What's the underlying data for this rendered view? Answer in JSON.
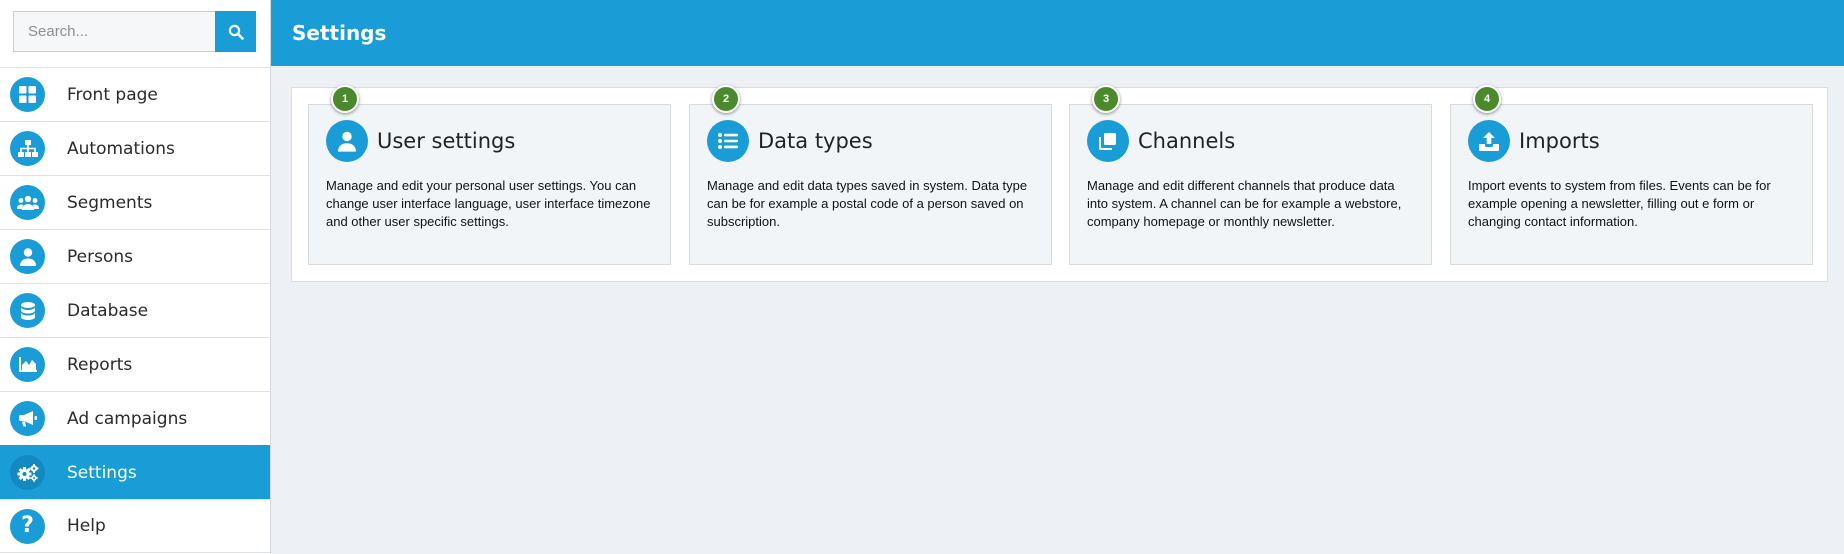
{
  "search": {
    "placeholder": "Search..."
  },
  "header": {
    "title": "Settings"
  },
  "sidebar": {
    "items": [
      {
        "label": "Front page",
        "icon": "grid-icon",
        "active": false
      },
      {
        "label": "Automations",
        "icon": "sitemap-icon",
        "active": false
      },
      {
        "label": "Segments",
        "icon": "users-icon",
        "active": false
      },
      {
        "label": "Persons",
        "icon": "user-icon",
        "active": false
      },
      {
        "label": "Database",
        "icon": "database-icon",
        "active": false
      },
      {
        "label": "Reports",
        "icon": "area-chart-icon",
        "active": false
      },
      {
        "label": "Ad campaigns",
        "icon": "megaphone-icon",
        "active": false
      },
      {
        "label": "Settings",
        "icon": "cogs-icon",
        "active": true
      },
      {
        "label": "Help",
        "icon": "question-icon",
        "active": false
      }
    ]
  },
  "cards": [
    {
      "badge": "1",
      "title": "User settings",
      "icon": "user-icon",
      "description": "Manage and edit your personal user settings. You can change user interface language, user interface timezone and other user specific settings."
    },
    {
      "badge": "2",
      "title": "Data types",
      "icon": "list-icon",
      "description": "Manage and edit data types saved in system. Data type can be for example a postal code of a person saved on subscription."
    },
    {
      "badge": "3",
      "title": "Channels",
      "icon": "clone-icon",
      "description": "Manage and edit different channels that produce data into system. A channel can be for example a webstore, company homepage or monthly newsletter."
    },
    {
      "badge": "4",
      "title": "Imports",
      "icon": "upload-icon",
      "description": "Import events to system from files. Events can be for example opening a newsletter, filling out e form or changing contact information."
    }
  ],
  "colors": {
    "accent": "#1a9cd6",
    "badge": "#4a8a2c",
    "background": "#edf1f5"
  }
}
